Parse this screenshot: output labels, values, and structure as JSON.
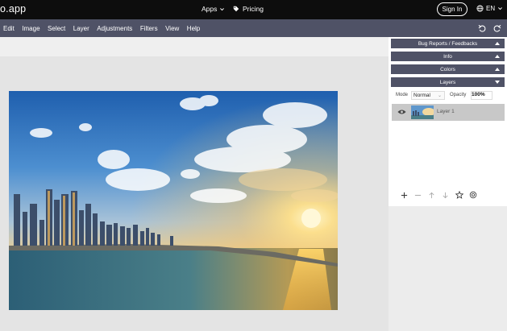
{
  "topbar": {
    "brand": "o.app",
    "apps_label": "Apps",
    "pricing_label": "Pricing",
    "signin_label": "Sign In",
    "lang_label": "EN"
  },
  "menubar": {
    "items": [
      "Edit",
      "Image",
      "Select",
      "Layer",
      "Adjustments",
      "Filters",
      "View",
      "Help"
    ]
  },
  "panels": {
    "bug_reports": "Bug Reports / Feedbacks",
    "info": "Info",
    "colors": "Colors",
    "layers": "Layers"
  },
  "layers": {
    "mode_label": "Mode",
    "mode_value": "Normal",
    "opacity_label": "Opacity",
    "opacity_value": "100%",
    "items": [
      {
        "name": "Layer 1",
        "visible": true
      }
    ]
  },
  "icons": {
    "apps": "chevron-down-icon",
    "pricing": "tag-icon",
    "lang": "globe-icon",
    "undo": "undo-icon",
    "redo": "redo-icon",
    "add_layer": "plus-icon",
    "remove_layer": "minus-icon",
    "move_up": "arrow-up-icon",
    "move_down": "arrow-down-icon",
    "effects": "star-icon",
    "settings": "gear-icon"
  },
  "colors": {
    "topbar": "#0d0d0d",
    "menubar": "#4f5266",
    "panel_header": "#4f5266",
    "workspace": "#e4e4e4",
    "selected_layer": "#c8c8c8"
  }
}
